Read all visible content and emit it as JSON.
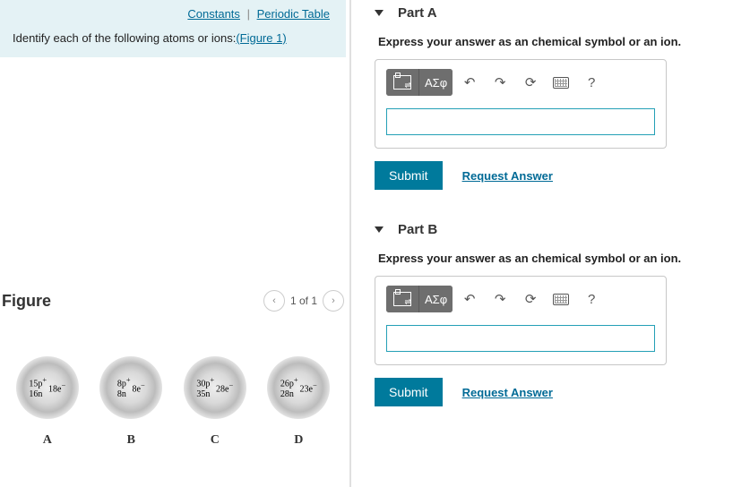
{
  "links": {
    "constants": "Constants",
    "periodic": "Periodic Table"
  },
  "prompt": {
    "text_pre": "Identify each of the following atoms or ions:",
    "fig_ref": "(Figure 1)"
  },
  "figure": {
    "heading": "Figure",
    "pager": {
      "text": "1 of 1"
    },
    "atoms": [
      {
        "id": "A",
        "protons": "15p",
        "neutrons": "16n",
        "electrons": "18e"
      },
      {
        "id": "B",
        "protons": "8p",
        "neutrons": "8n",
        "electrons": "8e"
      },
      {
        "id": "C",
        "protons": "30p",
        "neutrons": "35n",
        "electrons": "28e"
      },
      {
        "id": "D",
        "protons": "26p",
        "neutrons": "28n",
        "electrons": "23e"
      }
    ]
  },
  "parts": {
    "a": {
      "title": "Part A",
      "instruction": "Express your answer as an chemical symbol or an ion."
    },
    "b": {
      "title": "Part B",
      "instruction": "Express your answer as an chemical symbol or an ion."
    }
  },
  "toolbar": {
    "greek": "ΑΣφ",
    "help": "?"
  },
  "buttons": {
    "submit": "Submit",
    "request": "Request Answer"
  }
}
